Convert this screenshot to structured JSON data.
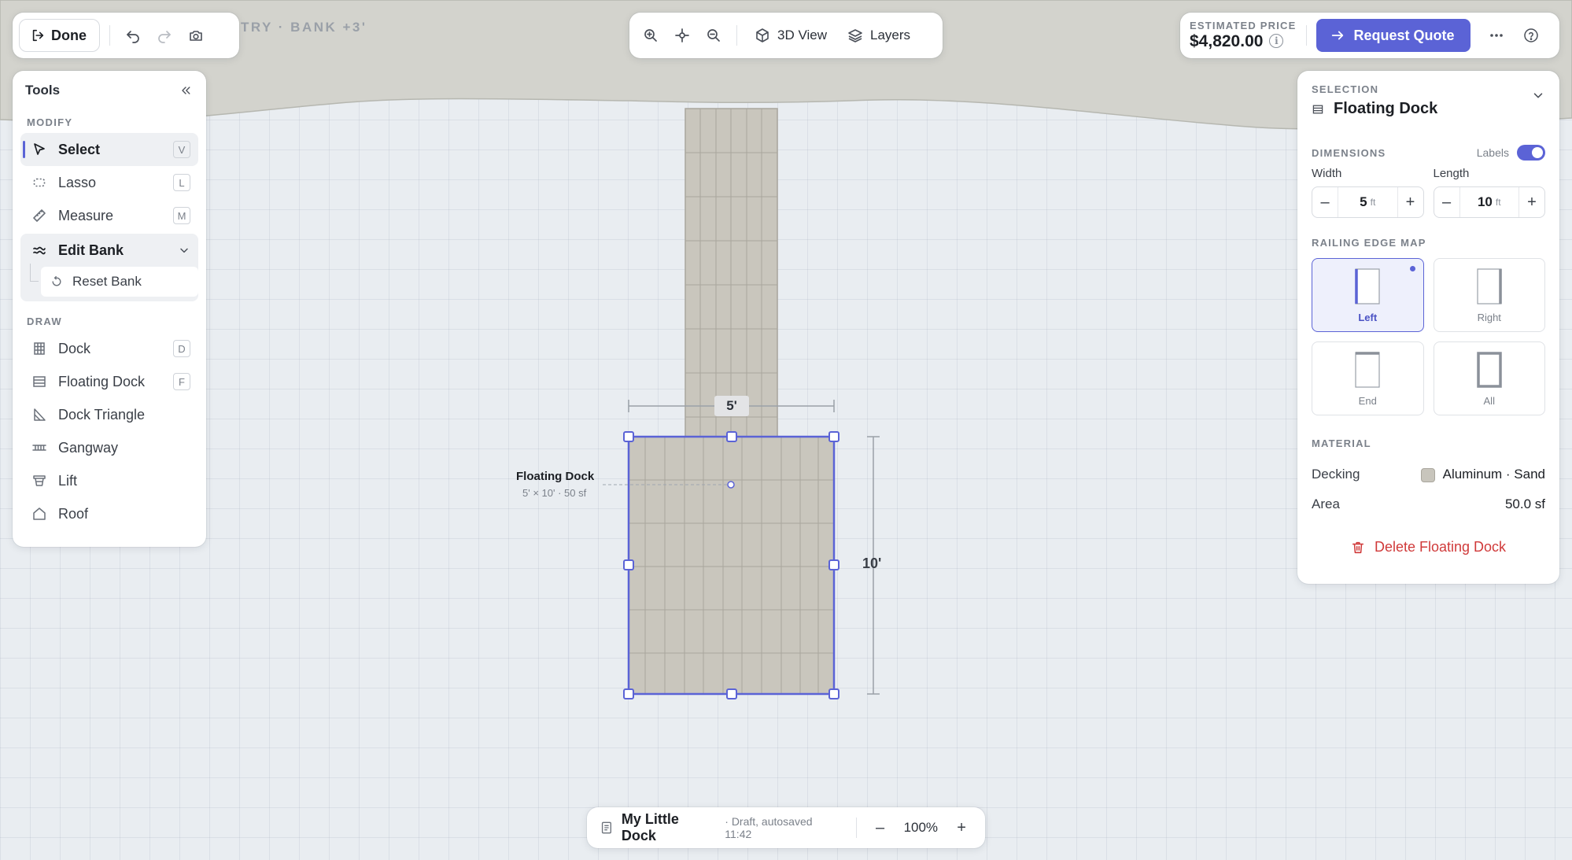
{
  "top_left": {
    "done_label": "Done",
    "breadcrumb": "TRY · BANK +3'"
  },
  "top_center": {
    "view_3d_label": "3D View",
    "layers_label": "Layers"
  },
  "top_right": {
    "price_label": "ESTIMATED PRICE",
    "price_value": "$4,820.00",
    "info_glyph": "i",
    "request_quote_label": "Request Quote"
  },
  "tools": {
    "title": "Tools",
    "modify_label": "MODIFY",
    "modify_items": [
      {
        "label": "Select",
        "key": "V",
        "icon": "cursor-icon",
        "active": true
      },
      {
        "label": "Lasso",
        "key": "L",
        "icon": "lasso-icon"
      },
      {
        "label": "Measure",
        "key": "M",
        "icon": "ruler-icon"
      }
    ],
    "edit_bank": {
      "label": "Edit Bank",
      "icon": "wave-icon",
      "sub_label": "Reset Bank"
    },
    "draw_label": "DRAW",
    "draw_items": [
      {
        "label": "Dock",
        "key": "D",
        "icon": "dock-icon"
      },
      {
        "label": "Floating Dock",
        "key": "F",
        "icon": "floating-dock-icon"
      },
      {
        "label": "Dock Triangle",
        "icon": "triangle-icon"
      },
      {
        "label": "Gangway",
        "icon": "gangway-icon"
      },
      {
        "label": "Lift",
        "icon": "lift-icon"
      },
      {
        "label": "Roof",
        "icon": "roof-icon"
      }
    ]
  },
  "canvas": {
    "selected_label": "Floating Dock",
    "selected_meta": "5' × 10' · 50 sf",
    "width_dim": "5'",
    "length_dim": "10'",
    "dock_color": "#c9c6bd",
    "selection_color": "#5b63d6"
  },
  "selection": {
    "section_label": "SELECTION",
    "title": "Floating Dock",
    "dimensions_label": "DIMENSIONS",
    "labels_toggle_label": "Labels",
    "labels_on": true,
    "width_label": "Width",
    "width_value": "5",
    "width_unit": "ft",
    "length_label": "Length",
    "length_value": "10",
    "length_unit": "ft",
    "railing_label": "RAILING EDGE MAP",
    "railing_options": [
      "Left",
      "Right",
      "End",
      "All"
    ],
    "railing_selected": "Left",
    "material_label": "MATERIAL",
    "decking_label": "Decking",
    "decking_value": "Aluminum · Sand",
    "area_label": "Area",
    "area_value": "50.0 sf",
    "delete_label": "Delete Floating Dock"
  },
  "bottom_bar": {
    "project_name": "My Little Dock",
    "project_meta": "· Draft, autosaved 11:42",
    "zoom_minus": "–",
    "zoom_value": "100%",
    "zoom_plus": "+"
  },
  "colors": {
    "accent": "#5b63d6",
    "danger": "#d03a3a",
    "bank": "#d3d3cd",
    "water": "#e9edf1"
  }
}
